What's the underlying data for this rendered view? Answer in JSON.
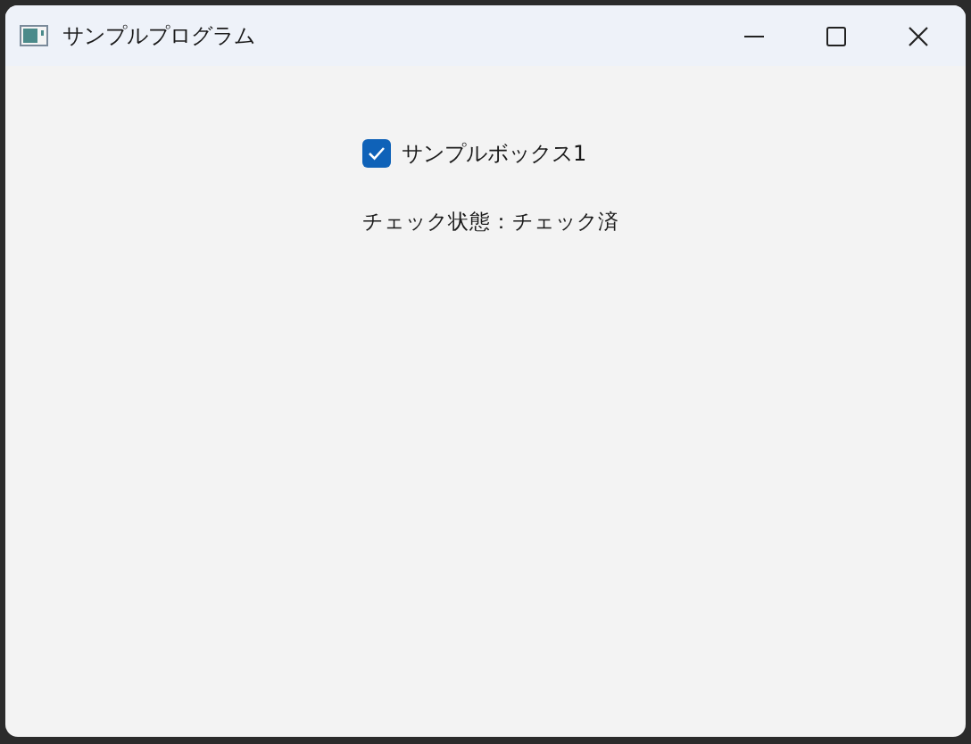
{
  "window": {
    "title": "サンプルプログラム"
  },
  "checkbox": {
    "label": "サンプルボックス1",
    "checked": true
  },
  "status_text": "チェック状態：チェック済"
}
